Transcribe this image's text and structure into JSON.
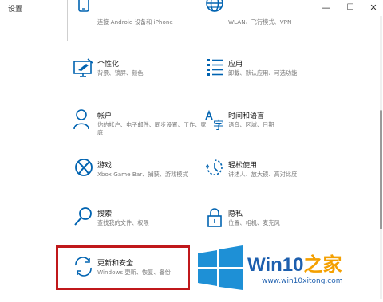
{
  "window": {
    "title": "设置",
    "min_glyph": "—",
    "max_glyph": "☐",
    "close_glyph": "✕"
  },
  "tiles": {
    "phone": {
      "desc": "连接 Android 设备和 iPhone",
      "icon": "phone-icon"
    },
    "network": {
      "desc": "WLAN、飞行模式、VPN",
      "icon": "globe-icon"
    },
    "personalization": {
      "label": "个性化",
      "desc": "背景、锁屏、颜色",
      "icon": "personalization-icon"
    },
    "apps": {
      "label": "应用",
      "desc": "卸载、默认应用、可选功能",
      "icon": "apps-list-icon"
    },
    "accounts": {
      "label": "帐户",
      "desc": "你的帐户、电子邮件、同步设置、工作、家庭",
      "icon": "person-icon"
    },
    "time_language": {
      "label": "时间和语言",
      "desc": "语音、区域、日期",
      "icon": "time-language-icon"
    },
    "gaming": {
      "label": "游戏",
      "desc": "Xbox Game Bar、捕获、游戏模式",
      "icon": "xbox-icon"
    },
    "ease_of_access": {
      "label": "轻松使用",
      "desc": "讲述人、放大镜、高对比度",
      "icon": "ease-of-access-icon"
    },
    "search": {
      "label": "搜索",
      "desc": "查找我的文件、权限",
      "icon": "search-icon"
    },
    "privacy": {
      "label": "隐私",
      "desc": "位置、相机、麦克风",
      "icon": "lock-icon"
    },
    "update_security": {
      "label": "更新和安全",
      "desc": "Windows 更新、恢复、备份",
      "icon": "sync-icon"
    }
  },
  "watermark": {
    "brand": "Win10",
    "brand_accent": "之家",
    "url": "www.win10xitong.com"
  },
  "colors": {
    "accent": "#0063b1",
    "highlight_outline": "#c0181b",
    "watermark_blue": "#1d5fae"
  }
}
